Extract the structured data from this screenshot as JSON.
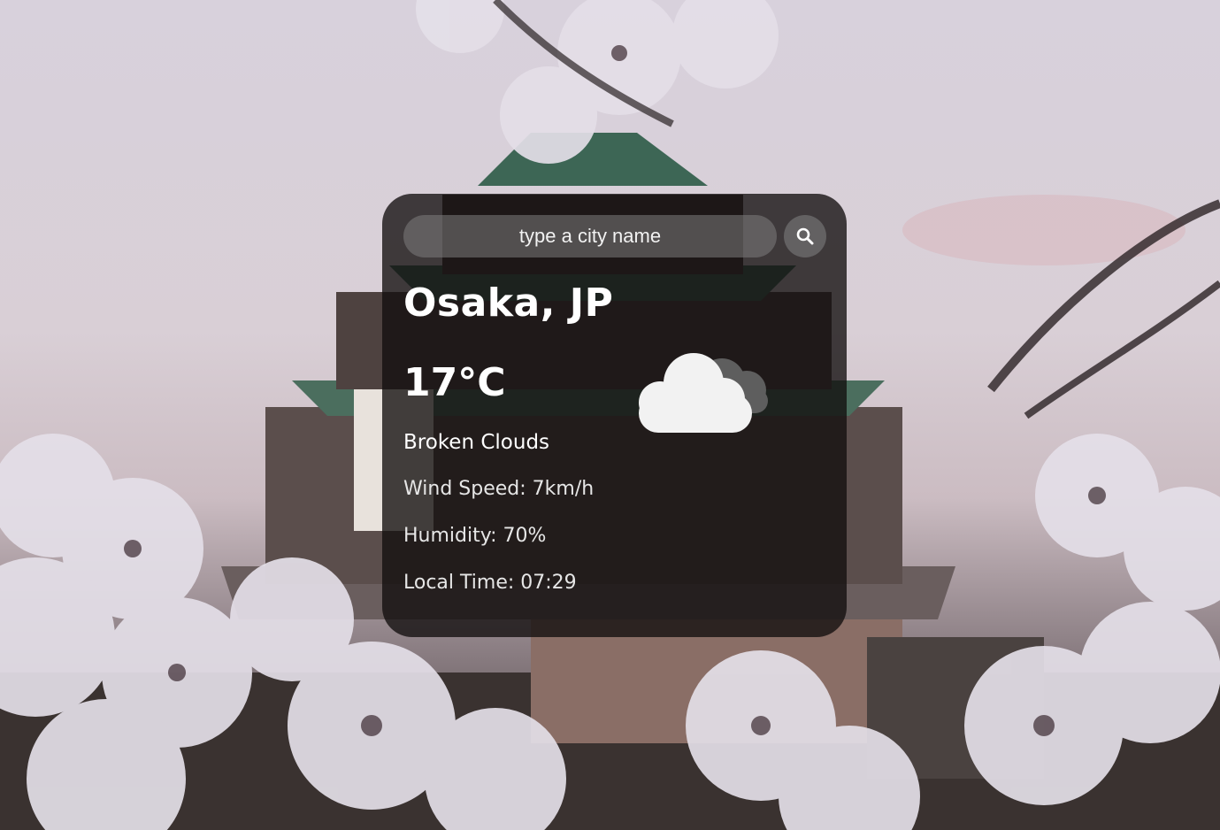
{
  "search": {
    "placeholder": "type a city name",
    "button_icon": "search-icon"
  },
  "weather": {
    "city": "Osaka, JP",
    "temperature": "17°C",
    "description": "Broken Clouds",
    "wind_speed": "Wind Speed: 7km/h",
    "humidity": "Humidity: 70%",
    "local_time": "Local Time: 07:29",
    "icon": "broken-clouds-icon"
  },
  "colors": {
    "card_background": "#120e0e",
    "text": "#ffffff",
    "input_background": "#7d7d7d"
  }
}
